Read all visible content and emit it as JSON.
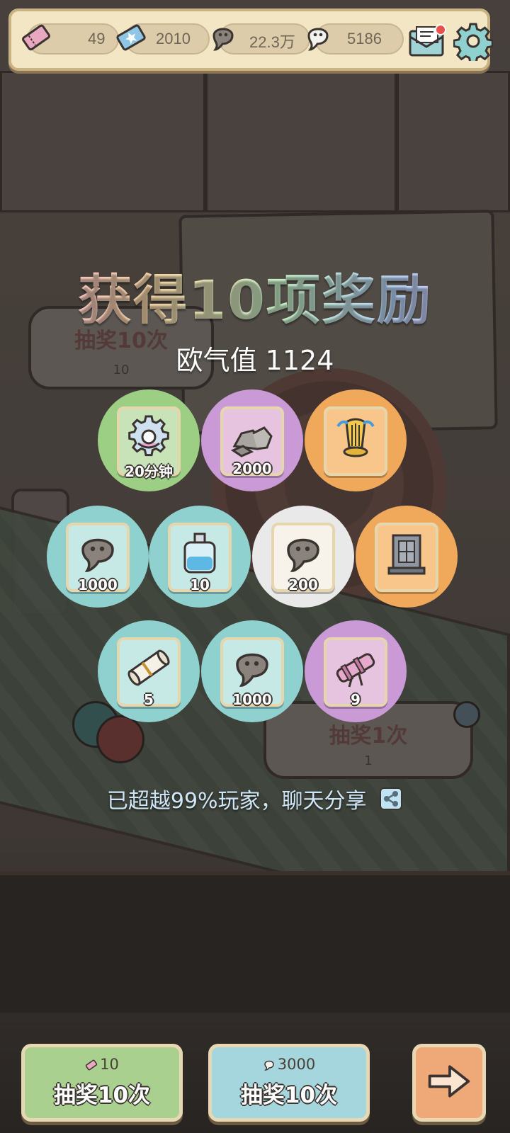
{
  "resources": {
    "ticket": "49",
    "star_ticket": "2010",
    "gray_spirit": "22.3万",
    "white_spirit": "5186"
  },
  "background": {
    "sign_left_text": "抽奖10次",
    "sign_left_cost": "10",
    "sign_right_text": "抽奖1次",
    "sign_right_cost": "1"
  },
  "reward_screen": {
    "title": "获得10项奖励",
    "luck_label": "欧气值 1124",
    "share_text": "已超越99%玩家，聊天分享"
  },
  "rewards": [
    {
      "item": "gear",
      "qty": "20分钟",
      "rarity": "green"
    },
    {
      "item": "stones",
      "qty": "2000",
      "rarity": "purple"
    },
    {
      "item": "golden-harp",
      "qty": "",
      "rarity": "orange"
    },
    {
      "item": "gray-spirit",
      "qty": "1000",
      "rarity": "teal"
    },
    {
      "item": "potion-bottle",
      "qty": "10",
      "rarity": "teal"
    },
    {
      "item": "gray-spirit",
      "qty": "200",
      "rarity": "white"
    },
    {
      "item": "stone-tablet",
      "qty": "",
      "rarity": "orange"
    },
    {
      "item": "scroll",
      "qty": "5",
      "rarity": "teal"
    },
    {
      "item": "gray-spirit",
      "qty": "1000",
      "rarity": "teal"
    },
    {
      "item": "cannon",
      "qty": "9",
      "rarity": "purple"
    }
  ],
  "colors": {
    "green": "#9ccf84",
    "purple": "#c99ad6",
    "orange": "#f0a95a",
    "teal": "#8fd1cf",
    "white": "#e9e9e9"
  },
  "buttons": {
    "draw_ticket": {
      "cost": "10",
      "label": "抽奖10次"
    },
    "draw_spirit": {
      "cost": "3000",
      "label": "抽奖10次"
    }
  }
}
